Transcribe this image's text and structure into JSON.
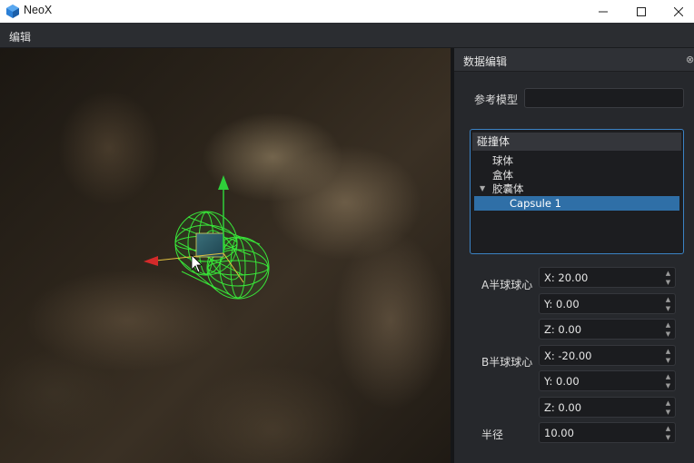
{
  "window": {
    "title": "NeoX"
  },
  "menu": {
    "edit_label": "编辑"
  },
  "panel": {
    "title": "数据编辑",
    "ref_model_label": "参考模型",
    "ref_model_value": "",
    "tree": {
      "header": "碰撞体",
      "items": [
        {
          "label": "球体"
        },
        {
          "label": "盒体"
        },
        {
          "label": "胶囊体",
          "expanded": true
        },
        {
          "label": "Capsule 1",
          "selected": true
        }
      ]
    },
    "a_center_label": "A半球球心",
    "b_center_label": "B半球球心",
    "radius_label": "半径",
    "a_x": "X: 20.00",
    "a_y": "Y: 0.00",
    "a_z": "Z: 0.00",
    "b_x": "X: -20.00",
    "b_y": "Y: 0.00",
    "b_z": "Z: 0.00",
    "radius": "10.00"
  },
  "colors": {
    "accent": "#3b82c4",
    "selection": "#2f6fa7",
    "wireframe": "#39e639",
    "gizmo_y": "#2fcf3a",
    "gizmo_x": "#d42a2a"
  }
}
